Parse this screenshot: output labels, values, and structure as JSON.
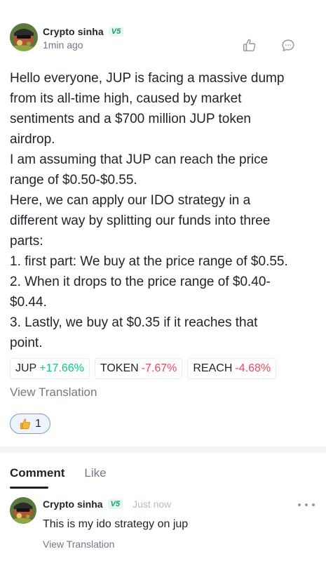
{
  "post": {
    "author": "Crypto sinha",
    "badge": "V5",
    "time": "1min ago",
    "lines": [
      "Hello everyone, JUP is facing a massive dump",
      "from its all-time high, caused by market",
      "sentiments and a $700 million JUP token",
      "airdrop.",
      "I am assuming that JUP can reach the price",
      "range of $0.50-$0.55.",
      "Here, we can apply our IDO strategy in a",
      "different way by splitting our funds into three",
      "parts:",
      "1. first part: We buy at the price range of $0.55.",
      "2. When it drops to the price range of $0.40-",
      "$0.44.",
      "3. Lastly, we buy at $0.35 if it reaches that",
      "point."
    ],
    "tickers": [
      {
        "symbol": "JUP",
        "change": "+17.66%",
        "direction": "up"
      },
      {
        "symbol": "TOKEN",
        "change": "-7.67%",
        "direction": "down"
      },
      {
        "symbol": "REACH",
        "change": "-4.68%",
        "direction": "down"
      }
    ],
    "view_translation": "View Translation",
    "reaction": {
      "icon": "thumbs-up-emoji",
      "count": "1"
    }
  },
  "tabs": {
    "comment": "Comment",
    "like": "Like"
  },
  "comment": {
    "author": "Crypto sinha",
    "badge": "V5",
    "time": "Just now",
    "text": "This is my ido strategy on jup",
    "view_translation": "View Translation"
  },
  "colors": {
    "up": "#0ecb81",
    "down": "#f6465d",
    "muted": "#707a8a",
    "badge_bg": "#e6f7ef",
    "badge_fg": "#0ea36a"
  }
}
